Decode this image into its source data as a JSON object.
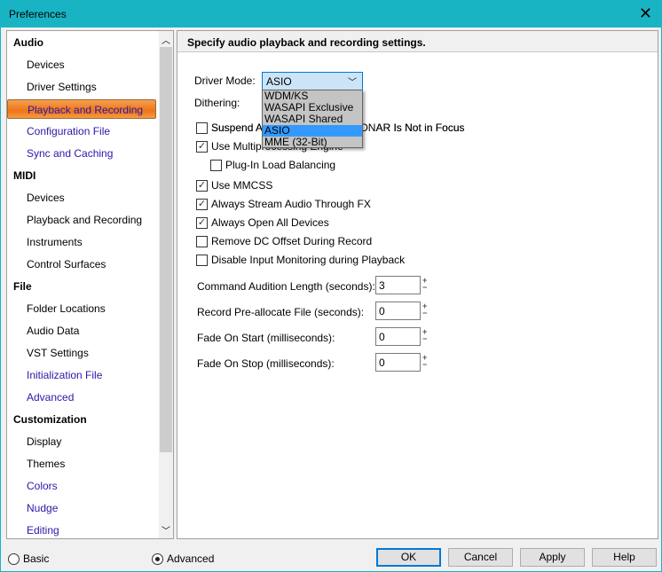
{
  "window": {
    "title": "Preferences",
    "close_icon": "close-icon"
  },
  "sidebar": {
    "items": [
      {
        "label": "Audio",
        "type": "header"
      },
      {
        "label": "Devices",
        "type": "item",
        "color": "black"
      },
      {
        "label": "Driver Settings",
        "type": "item",
        "color": "black"
      },
      {
        "label": "Playback and Recording",
        "type": "item",
        "color": "blue",
        "selected": true
      },
      {
        "label": "Configuration File",
        "type": "item",
        "color": "blue"
      },
      {
        "label": "Sync and Caching",
        "type": "item",
        "color": "blue"
      },
      {
        "label": "MIDI",
        "type": "header"
      },
      {
        "label": "Devices",
        "type": "item",
        "color": "black"
      },
      {
        "label": "Playback and Recording",
        "type": "item",
        "color": "black"
      },
      {
        "label": "Instruments",
        "type": "item",
        "color": "black"
      },
      {
        "label": "Control Surfaces",
        "type": "item",
        "color": "black"
      },
      {
        "label": "File",
        "type": "header"
      },
      {
        "label": "Folder Locations",
        "type": "item",
        "color": "black"
      },
      {
        "label": "Audio Data",
        "type": "item",
        "color": "black"
      },
      {
        "label": "VST Settings",
        "type": "item",
        "color": "black"
      },
      {
        "label": "Initialization File",
        "type": "item",
        "color": "blue"
      },
      {
        "label": "Advanced",
        "type": "item",
        "color": "blue"
      },
      {
        "label": "Customization",
        "type": "header"
      },
      {
        "label": "Display",
        "type": "item",
        "color": "black"
      },
      {
        "label": "Themes",
        "type": "item",
        "color": "black"
      },
      {
        "label": "Colors",
        "type": "item",
        "color": "blue"
      },
      {
        "label": "Nudge",
        "type": "item",
        "color": "blue"
      },
      {
        "label": "Editing",
        "type": "item",
        "color": "blue"
      }
    ]
  },
  "main": {
    "header": "Specify audio playback and recording settings.",
    "driver_mode_label": "Driver Mode:",
    "driver_mode_value": "ASIO",
    "driver_mode_options": [
      "WDM/KS",
      "WASAPI Exclusive",
      "WASAPI Shared",
      "ASIO",
      "MME (32-Bit)"
    ],
    "dithering_label": "Dithering:",
    "checkboxes": [
      {
        "label": "Suspend Audio Engine When SONAR Is Not in Focus",
        "visible_prefix": "Suspend Au",
        "visible_suffix": "AR Is Not in Focus",
        "checked": false
      },
      {
        "label": "Use Multiprocessing Engine",
        "checked": true
      },
      {
        "label": "Plug-In Load Balancing",
        "checked": false
      },
      {
        "label": "Use MMCSS",
        "checked": true
      },
      {
        "label": "Always Stream Audio Through FX",
        "checked": true
      },
      {
        "label": "Always Open All Devices",
        "checked": true
      },
      {
        "label": "Remove DC Offset During Record",
        "checked": false
      },
      {
        "label": "Disable Input Monitoring during Playback",
        "checked": false
      }
    ],
    "fields": [
      {
        "label": "Command Audition Length (seconds):",
        "value": "3"
      },
      {
        "label": "Record Pre-allocate File (seconds):",
        "value": "0"
      },
      {
        "label": "Fade On Start  (milliseconds):",
        "value": "0"
      },
      {
        "label": "Fade On Stop  (milliseconds):",
        "value": "0"
      }
    ]
  },
  "footer": {
    "basic": "Basic",
    "advanced": "Advanced",
    "mode_selected": "Advanced",
    "ok": "OK",
    "cancel": "Cancel",
    "apply": "Apply",
    "help": "Help"
  }
}
